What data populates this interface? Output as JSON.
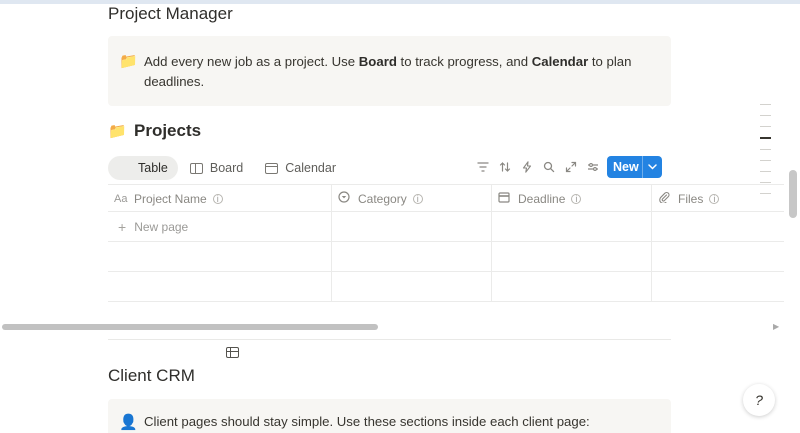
{
  "section1": {
    "title": "Project Manager",
    "callout_icon": "folder-icon",
    "callout_parts": [
      "Add every new job as a project. Use ",
      "Board",
      " to track progress, and ",
      "Calendar",
      " to plan deadlines."
    ]
  },
  "database": {
    "emoji": "📁",
    "title": "Projects",
    "views": [
      {
        "label": "Table",
        "icon": "table-icon",
        "active": true
      },
      {
        "label": "Board",
        "icon": "board-icon",
        "active": false
      },
      {
        "label": "Calendar",
        "icon": "calendar-icon",
        "active": false
      }
    ],
    "tools": [
      "filter-icon",
      "sort-icon",
      "lightning-icon",
      "search-icon",
      "expand-icon",
      "settings-icon"
    ],
    "new_label": "New",
    "columns": [
      {
        "label": "Project Name",
        "icon": "Aa"
      },
      {
        "label": "Category",
        "icon": "select-icon"
      },
      {
        "label": "Deadline",
        "icon": "calendar-icon"
      },
      {
        "label": "Files",
        "icon": "paperclip-icon"
      }
    ],
    "new_page_label": "New page"
  },
  "section2": {
    "title": "Client CRM",
    "callout_icon": "person-icon",
    "callout_text": "Client pages should stay simple. Use these sections inside each client page:"
  },
  "help_label": "?"
}
